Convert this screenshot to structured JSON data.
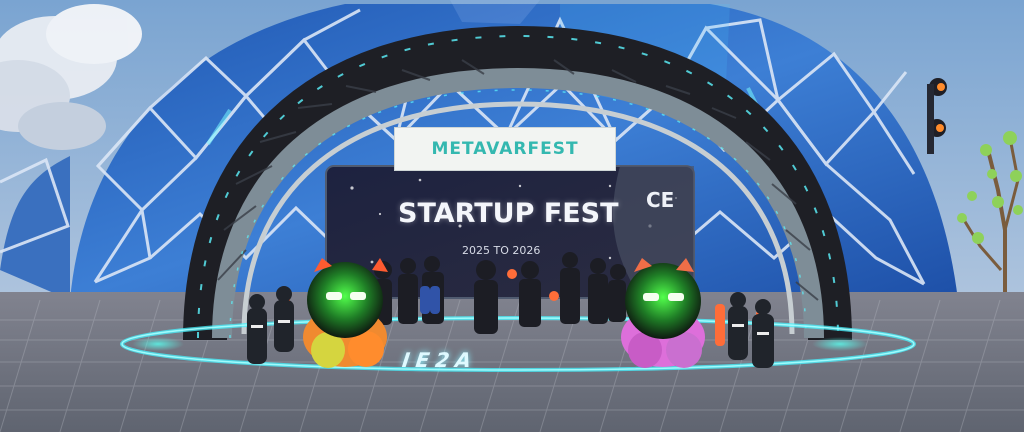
{
  "scene": {
    "banner_text": "METAVARFEST",
    "screen_title": "STARTUP FEST",
    "screen_subtitle": "2025 TO 2026",
    "screen_corner_text": "CE",
    "floor_text": "IE2A"
  },
  "colors": {
    "sky": "#8fb0cf",
    "dome_blue": "#2c5fb8",
    "dome_frame": "#dfe9f8",
    "arch": "#6c7b86",
    "neon_teal": "#34d3d0",
    "neon_green": "#3cff60",
    "ground": "#6f7481"
  },
  "icons": [
    "dome-icon",
    "arch-icon",
    "screen-icon",
    "robot-icon",
    "tree-icon",
    "spotlight-icon",
    "cloud-icon",
    "crowd-icon"
  ]
}
